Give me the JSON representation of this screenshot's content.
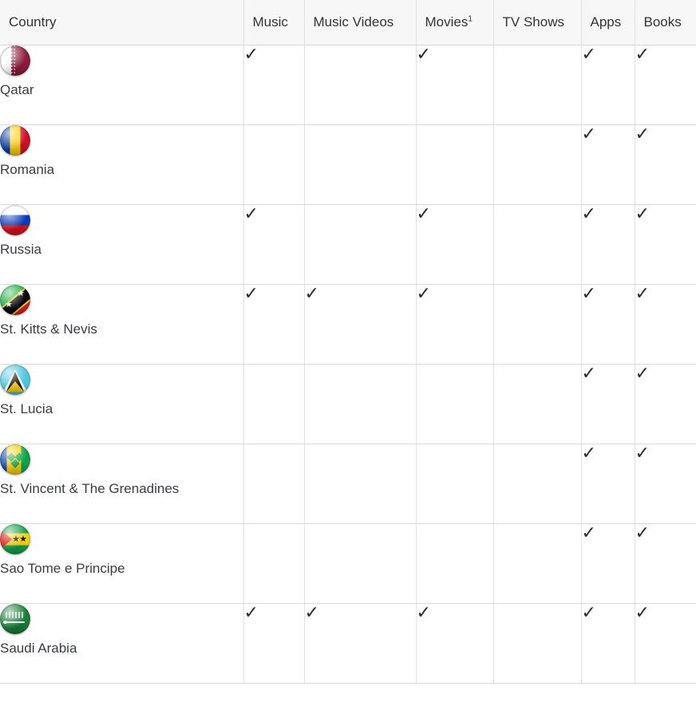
{
  "table": {
    "columns": [
      {
        "key": "country",
        "label": "Country",
        "footnote": ""
      },
      {
        "key": "music",
        "label": "Music",
        "footnote": ""
      },
      {
        "key": "music_videos",
        "label": "Music Videos",
        "footnote": ""
      },
      {
        "key": "movies",
        "label": "Movies",
        "footnote": "1"
      },
      {
        "key": "tv_shows",
        "label": "TV Shows",
        "footnote": ""
      },
      {
        "key": "apps",
        "label": "Apps",
        "footnote": ""
      },
      {
        "key": "books",
        "label": "Books",
        "footnote": ""
      }
    ],
    "check_glyph": "✓",
    "rows": [
      {
        "country": "Qatar",
        "flag": "qatar-flag-icon",
        "music": "✓",
        "music_videos": "",
        "movies": "✓",
        "tv_shows": "",
        "apps": "✓",
        "books": "✓"
      },
      {
        "country": "Romania",
        "flag": "romania-flag-icon",
        "music": "",
        "music_videos": "",
        "movies": "",
        "tv_shows": "",
        "apps": "✓",
        "books": "✓"
      },
      {
        "country": "Russia",
        "flag": "russia-flag-icon",
        "music": "✓",
        "music_videos": "",
        "movies": "✓",
        "tv_shows": "",
        "apps": "✓",
        "books": "✓"
      },
      {
        "country": "St. Kitts & Nevis",
        "flag": "st-kitts-and-nevis-flag-icon",
        "music": "✓",
        "music_videos": "✓",
        "movies": "✓",
        "tv_shows": "",
        "apps": "✓",
        "books": "✓"
      },
      {
        "country": "St. Lucia",
        "flag": "st-lucia-flag-icon",
        "music": "",
        "music_videos": "",
        "movies": "",
        "tv_shows": "",
        "apps": "✓",
        "books": "✓"
      },
      {
        "country": "St. Vincent & The Grenadines",
        "flag": "st-vincent-and-the-grenadines-flag-icon",
        "music": "",
        "music_videos": "",
        "movies": "",
        "tv_shows": "",
        "apps": "✓",
        "books": "✓"
      },
      {
        "country": "Sao Tome e Principe",
        "flag": "sao-tome-e-principe-flag-icon",
        "music": "",
        "music_videos": "",
        "movies": "",
        "tv_shows": "",
        "apps": "✓",
        "books": "✓"
      },
      {
        "country": "Saudi Arabia",
        "flag": "saudi-arabia-flag-icon",
        "music": "✓",
        "music_videos": "✓",
        "movies": "✓",
        "tv_shows": "",
        "apps": "✓",
        "books": "✓"
      }
    ]
  },
  "colors": {
    "header_background": "#f7f7f7",
    "header_border": "#d6d6d6",
    "row_border": "#d9d9d9",
    "column_border": "#e2e2e2",
    "text": "#333333",
    "country_text": "#3b3b47",
    "check_color": "#2b2b2b"
  }
}
